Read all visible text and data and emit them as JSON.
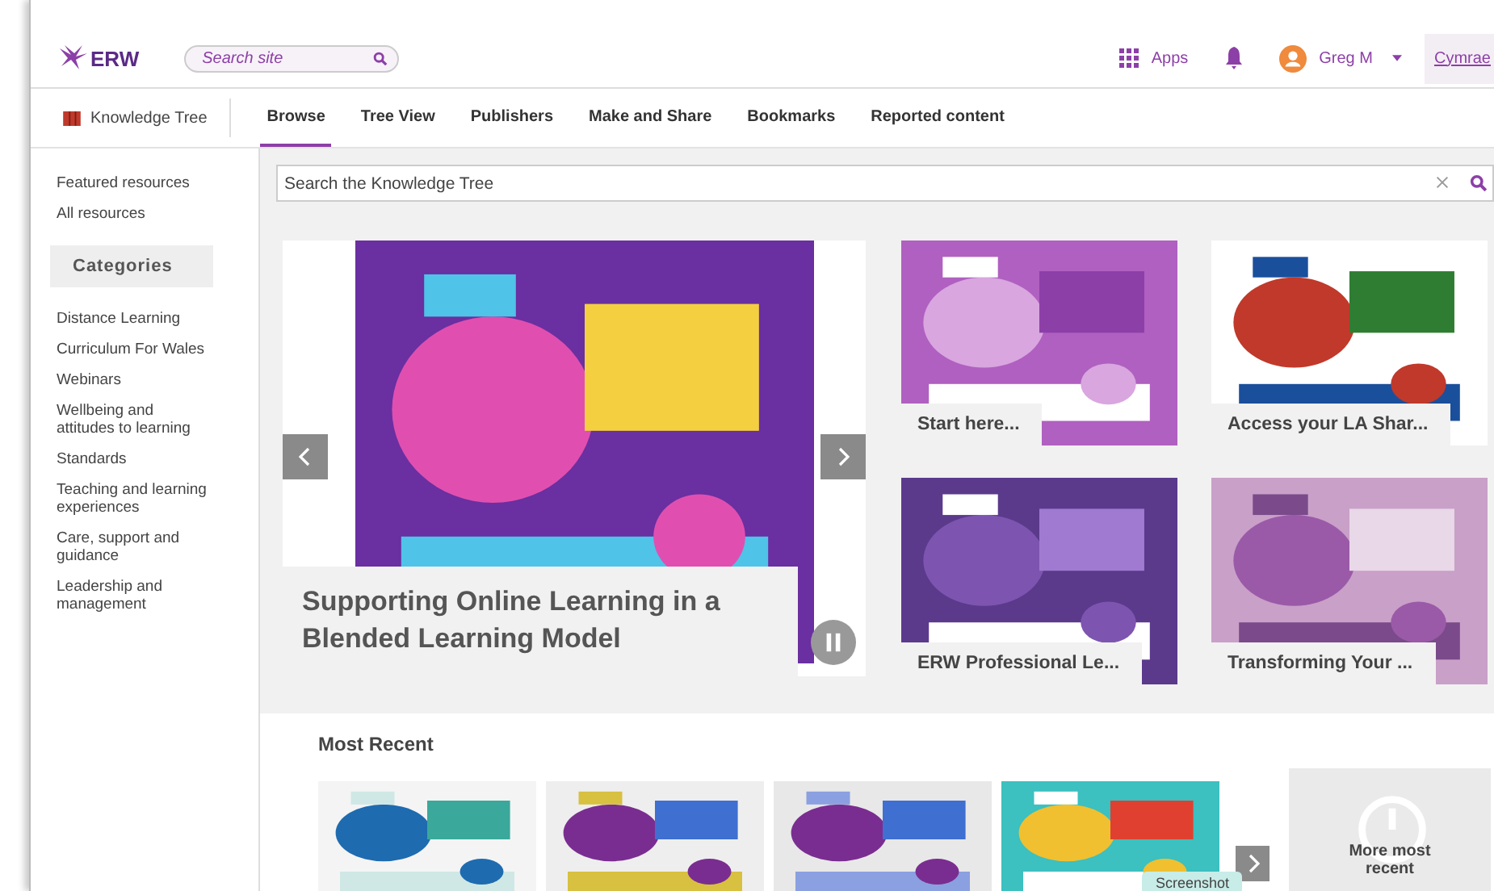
{
  "header": {
    "logo": "ERW",
    "search": {
      "placeholder": "Search site"
    },
    "apps": "Apps",
    "user": "Greg M",
    "language": "Cymrae"
  },
  "nav": {
    "brand": "Knowledge Tree",
    "tabs": [
      {
        "label": "Browse",
        "selected": true
      },
      {
        "label": "Tree View",
        "selected": false
      },
      {
        "label": "Publishers",
        "selected": false
      },
      {
        "label": "Make and Share",
        "selected": false
      },
      {
        "label": "Bookmarks",
        "selected": false
      },
      {
        "label": "Reported content",
        "selected": false
      }
    ]
  },
  "sidebar": {
    "links": [
      "Featured resources",
      "All resources"
    ],
    "categories_heading": "Categories",
    "categories": [
      "Distance Learning",
      "Curriculum For Wales",
      "Webinars",
      "Wellbeing and attitudes to learning",
      "Standards",
      "Teaching and learning experiences",
      "Care, support and guidance",
      "Leadership and management"
    ]
  },
  "search": {
    "placeholder": "Search the Knowledge Tree"
  },
  "featured": {
    "caption": "Supporting Online Learning in a Blended Learning Model"
  },
  "tiles": [
    {
      "caption": "Start here..."
    },
    {
      "caption": "Access your LA Shar..."
    },
    {
      "caption": "ERW Professional Le..."
    },
    {
      "caption": "Transforming Your ..."
    }
  ],
  "most_recent": {
    "title": "Most Recent",
    "tooltip": "Screenshot",
    "more": "More most recent"
  }
}
